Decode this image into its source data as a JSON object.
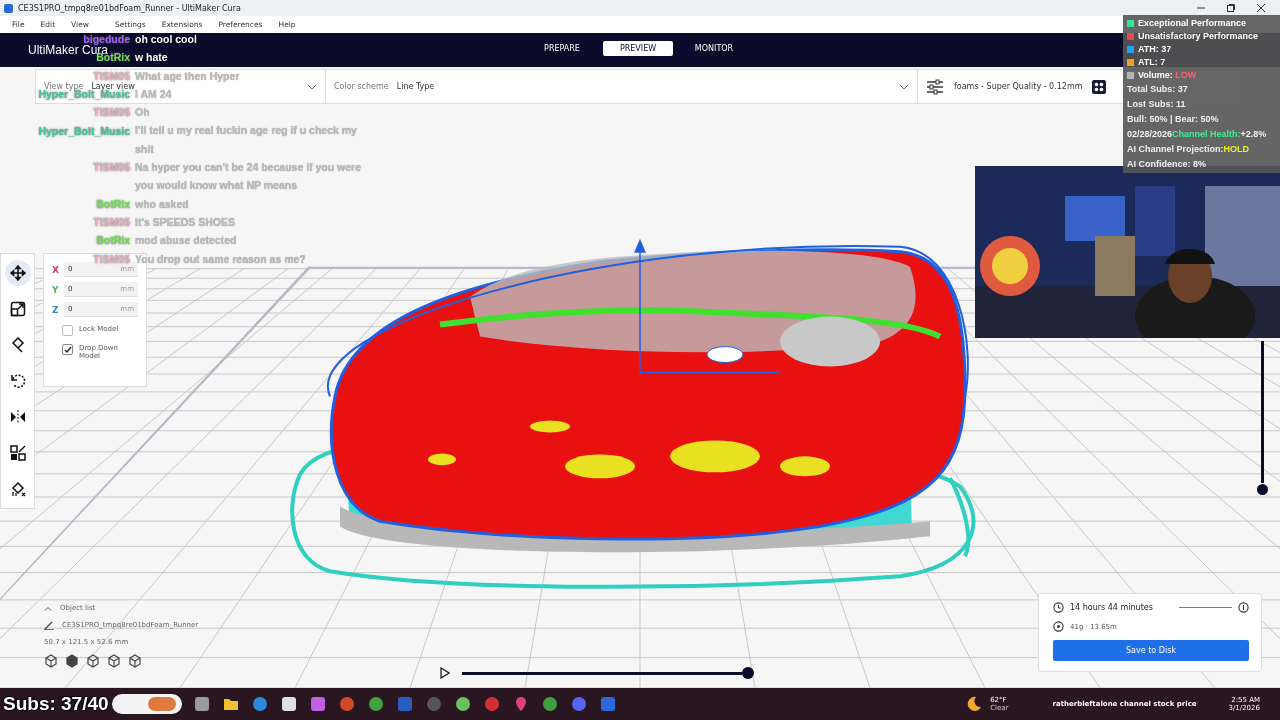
{
  "window": {
    "title": "CE3S1PRO_tmpq8re01bdFoam_Runner - UltiMaker Cura"
  },
  "menu": [
    "File",
    "Edit",
    "View",
    "Settings",
    "Extensions",
    "Preferences",
    "Help"
  ],
  "header": {
    "logo": "UltiMaker Cura",
    "stages": [
      {
        "label": "PREPARE",
        "selected": false
      },
      {
        "label": "PREVIEW",
        "selected": true
      },
      {
        "label": "MONITOR",
        "selected": false
      }
    ]
  },
  "view_bar": {
    "view_type_label": "View type",
    "view_type": "Layer view",
    "color_scheme_label": "Color scheme",
    "color_scheme": "Line Type",
    "profile": "foams - Super Quality - 0.12mm"
  },
  "tools": [
    {
      "kind": "move",
      "selected": true
    },
    {
      "kind": "scale",
      "selected": false
    },
    {
      "kind": "paint",
      "selected": false
    },
    {
      "kind": "rotate",
      "selected": false
    },
    {
      "kind": "mirror",
      "selected": false
    },
    {
      "kind": "per-model",
      "selected": false
    },
    {
      "kind": "support",
      "selected": false
    }
  ],
  "move_panel": {
    "fields": [
      {
        "axis": "X",
        "value": "0",
        "unit": "mm",
        "color": "#d04060"
      },
      {
        "axis": "Y",
        "value": "0",
        "unit": "mm",
        "color": "#50b060"
      },
      {
        "axis": "Z",
        "value": "0",
        "unit": "mm",
        "color": "#4080d0"
      }
    ],
    "options": [
      {
        "label": "Lock Model",
        "checked": false
      },
      {
        "label": "Drop Down Model",
        "checked": true
      }
    ]
  },
  "object_list": {
    "title": "Object list",
    "name": "CE3S1PRO_tmpq8re01bdFoam_Runner",
    "dimensions": "50.7 x 121.5 x 52.6 mm"
  },
  "layer_slider": {
    "level": 1
  },
  "vertical_slider": {
    "level": 1
  },
  "print_info": {
    "time": "14 hours 44 minutes",
    "material": "41g · 13.65m",
    "button": "Save to Disk"
  },
  "chat": [
    {
      "user": "bigedude",
      "color": "#a060f0",
      "text": "oh cool cool",
      "faded": false
    },
    {
      "user": "BotRix",
      "color": "#70e050",
      "text": "w hate",
      "faded": false
    },
    {
      "user": "TISM05",
      "color": "#e8b0c0",
      "text": "What age then Hyper",
      "faded": true
    },
    {
      "user": "Hyper_Bolt_Music",
      "color": "#40c8a0",
      "text": "I AM 24",
      "faded": true
    },
    {
      "user": "TISM05",
      "color": "#e8b0c0",
      "text": "Oh",
      "faded": true
    },
    {
      "user": "Hyper_Bolt_Music",
      "color": "#40c8a0",
      "text": "I'll tell u my real fuckin age reg if u check my shit",
      "faded": true
    },
    {
      "user": "TISM05",
      "color": "#e8b0c0",
      "text": "Na hyper you can't be 24 because if you were you would know what NP means",
      "faded": true
    },
    {
      "user": "BotRix",
      "color": "#70e050",
      "text": "who asked",
      "faded": true
    },
    {
      "user": "TISM05",
      "color": "#e8b0c0",
      "text": "It's SPEEDS SHOES",
      "faded": true
    },
    {
      "user": "BotRix",
      "color": "#70e050",
      "text": "mod abuse detected",
      "faded": true
    },
    {
      "user": "TISM05",
      "color": "#e8b0c0",
      "text": "You drop out same reason as me?",
      "faded": true
    }
  ],
  "stats": {
    "legend": [
      {
        "label": "Exceptional Performance",
        "color": "#30e890"
      },
      {
        "label": "Unsatisfactory Performance",
        "color": "#e84858"
      },
      {
        "label": "ATH: 37",
        "color": "#2aa0f4"
      },
      {
        "label": "ATL: 7",
        "color": "#f0a020"
      },
      {
        "label": "Volume:",
        "value": "LOW",
        "color": "#b4b4b4"
      }
    ],
    "lines": [
      [
        {
          "text": "Total Subs: 37",
          "color": "#f0f0f0"
        }
      ],
      [
        {
          "text": "Lost Subs: 11",
          "color": "#f0f0f0"
        }
      ],
      [
        {
          "text": "Bull: 50% | Bear: 50%",
          "color": "#f0f0f0"
        }
      ],
      [
        {
          "text": "02/28/2026",
          "color": "#f0f0f0"
        },
        {
          "text": "Channel Health:",
          "color": "#40f090"
        },
        {
          "text": "+2.8%",
          "color": "#f0f0f0"
        }
      ],
      [
        {
          "text": "AI Channel Projection:",
          "color": "#f0f0f0"
        },
        {
          "text": "HOLD",
          "color": "#f0f020"
        }
      ],
      [
        {
          "text": "AI Confidence: 8%",
          "color": "#f0f0f0"
        }
      ]
    ]
  },
  "subs_counter": "Subs: 37/40",
  "taskbar": {
    "weather_temp": "62°F",
    "weather": "Clear",
    "ticker": "ratherbleftalone channel stock price",
    "time": "2:55 AM",
    "date": "3/1/2026"
  }
}
